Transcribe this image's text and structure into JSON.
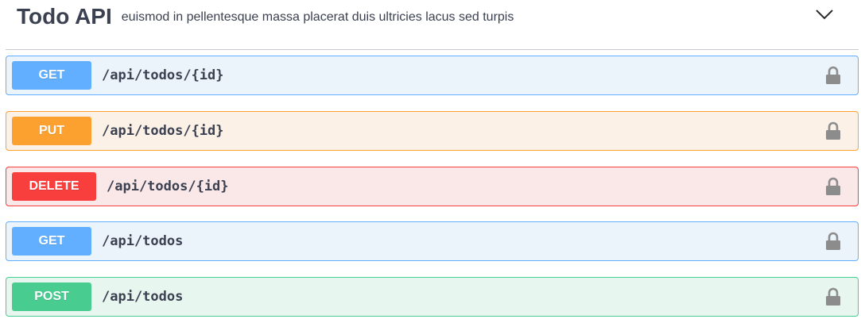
{
  "tag": {
    "title": "Todo API",
    "description": "euismod in pellentesque massa placerat duis ultricies lacus sed turpis",
    "expand_icon": "chevron-down-icon"
  },
  "operations": [
    {
      "method": "GET",
      "path": "/api/todos/{id}",
      "color": "#61affe",
      "lock_icon": "lock-icon"
    },
    {
      "method": "PUT",
      "path": "/api/todos/{id}",
      "color": "#fca130",
      "lock_icon": "lock-icon"
    },
    {
      "method": "DELETE",
      "path": "/api/todos/{id}",
      "color": "#f93e3e",
      "lock_icon": "lock-icon"
    },
    {
      "method": "GET",
      "path": "/api/todos",
      "color": "#61affe",
      "lock_icon": "lock-icon"
    },
    {
      "method": "POST",
      "path": "/api/todos",
      "color": "#49cc90",
      "lock_icon": "lock-icon"
    }
  ]
}
